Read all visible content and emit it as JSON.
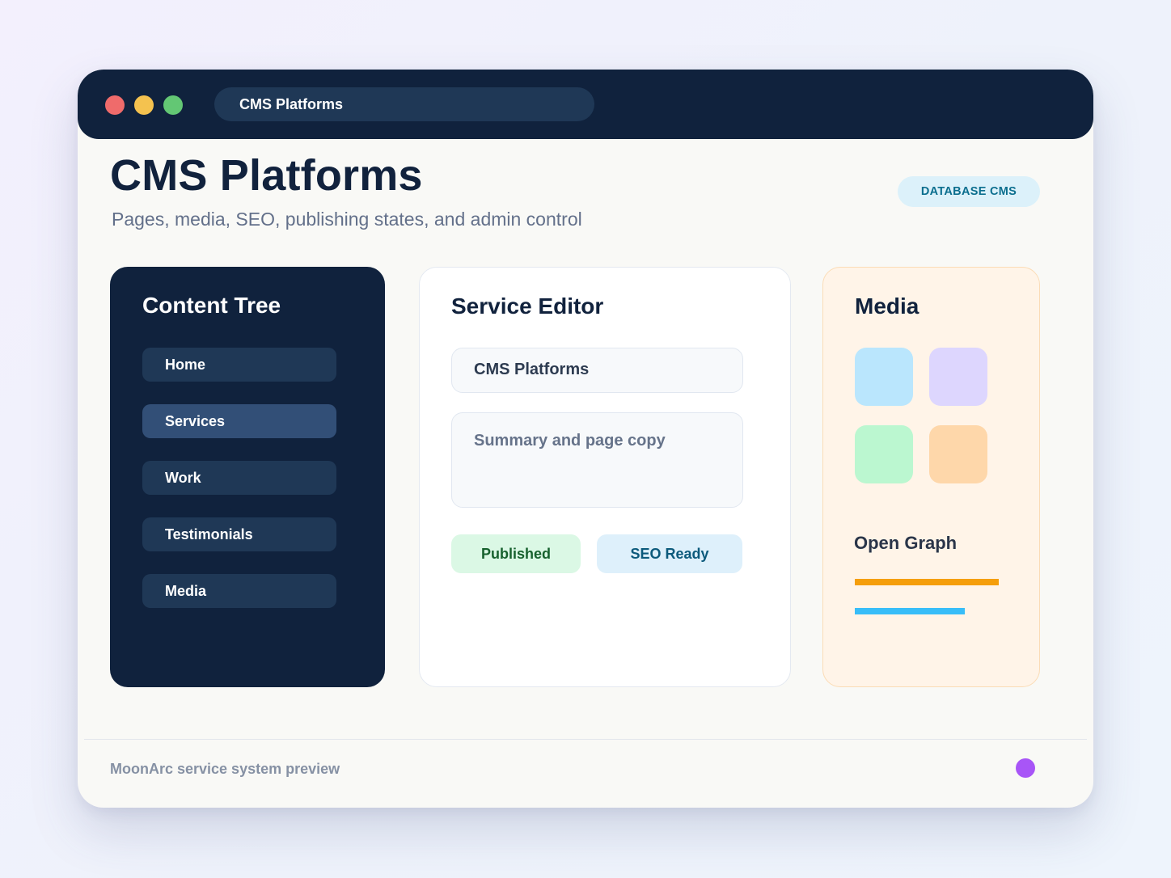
{
  "window": {
    "address_bar": "CMS Platforms"
  },
  "header": {
    "title": "CMS Platforms",
    "subtitle": "Pages, media, SEO, publishing states, and admin control",
    "badge": "DATABASE CMS"
  },
  "content_tree": {
    "title": "Content Tree",
    "items": [
      {
        "label": "Home",
        "active": false
      },
      {
        "label": "Services",
        "active": true
      },
      {
        "label": "Work",
        "active": false
      },
      {
        "label": "Testimonials",
        "active": false
      },
      {
        "label": "Media",
        "active": false
      }
    ]
  },
  "editor": {
    "title": "Service Editor",
    "title_field_value": "CMS Platforms",
    "summary_placeholder": "Summary and page copy",
    "status_chips": [
      "Published",
      "SEO Ready"
    ]
  },
  "media": {
    "title": "Media",
    "thumbnail_colors": [
      "#bae6fd",
      "#ddd6fe",
      "#bbf7d0",
      "#fed7aa"
    ],
    "open_graph_title": "Open Graph",
    "open_graph_bar_colors": [
      "#f59e0b",
      "#38bdf8"
    ]
  },
  "footer": {
    "text": "MoonArc service system preview",
    "dot_color": "#a855f7"
  }
}
